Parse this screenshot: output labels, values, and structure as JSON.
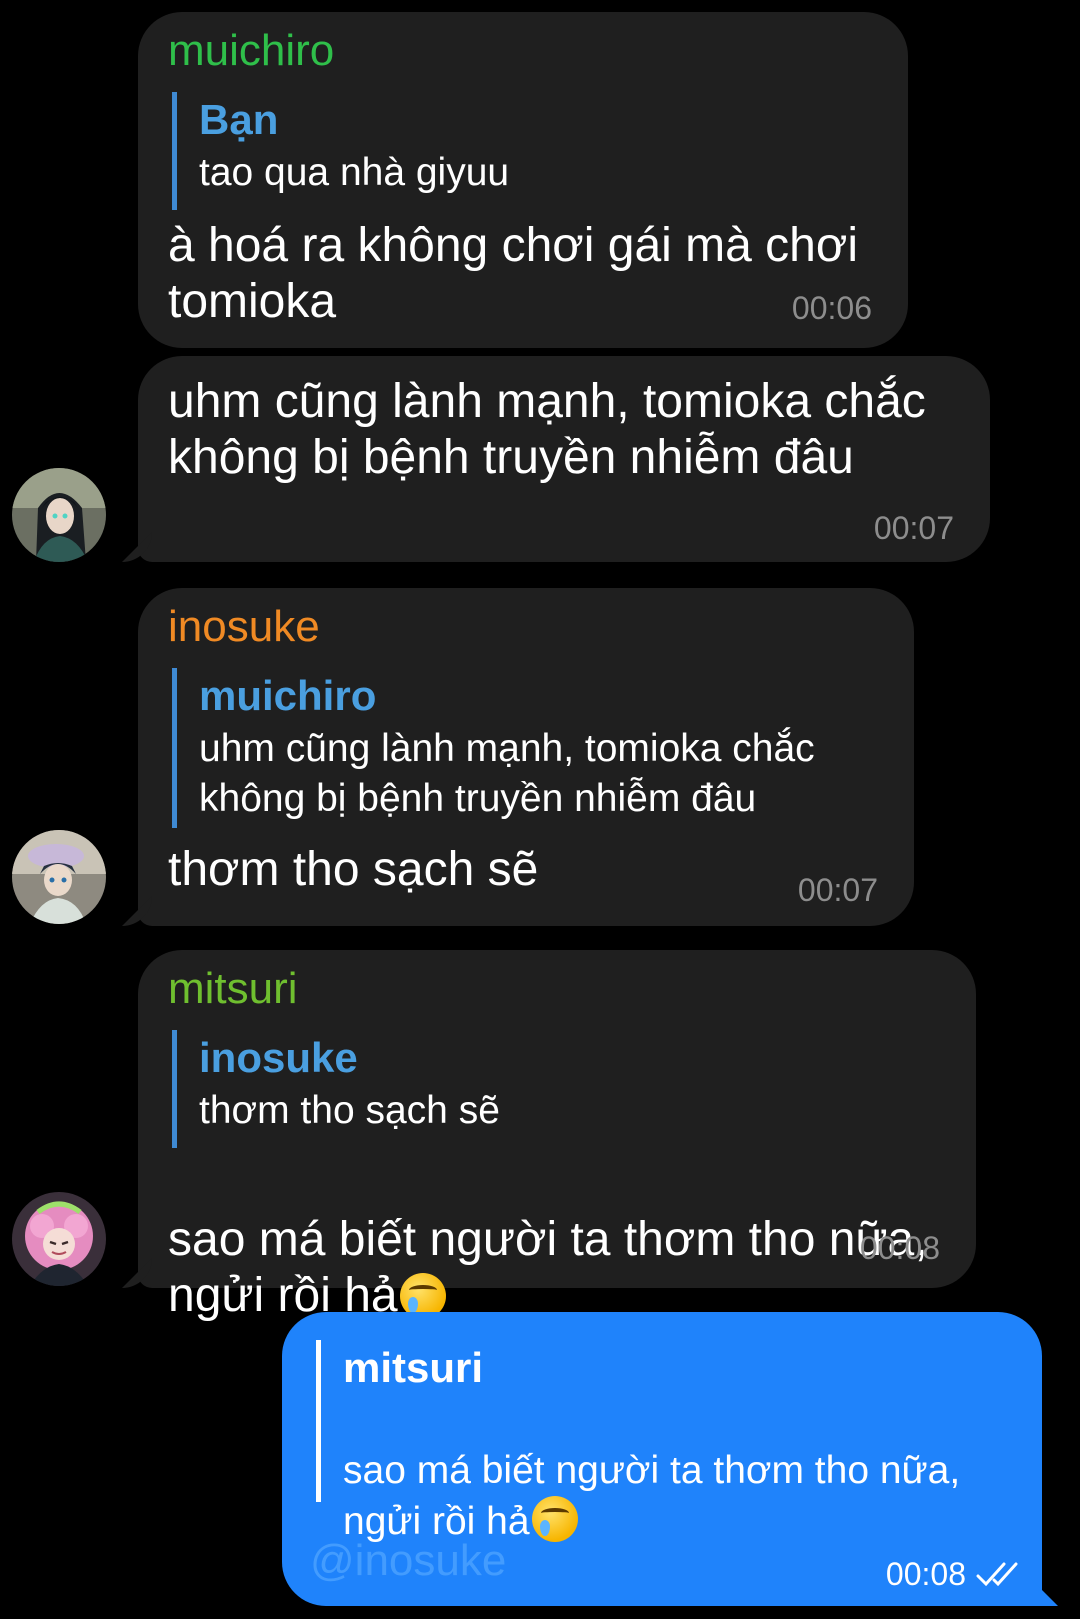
{
  "colors": {
    "background": "#000000",
    "bubble_in": "#1f1f1f",
    "bubble_out": "#1f83fb",
    "quote_bar": "#3f8ad3",
    "time_in": "#8d8d8d"
  },
  "messages": [
    {
      "sender": "muichiro",
      "sender_color": "#2fbf4a",
      "reply_name": "Bạn",
      "reply_text": "tao qua nhà giyuu",
      "text": "à hoá ra không chơi gái mà chơi\ntomioka",
      "time": "00:06"
    },
    {
      "text": "uhm cũng lành mạnh, tomioka chắc\nkhông bị bệnh truyền nhiễm đâu",
      "time": "00:07",
      "avatar": "muichiro-avatar"
    },
    {
      "sender": "inosuke",
      "sender_color": "#f08a24",
      "reply_name": "muichiro",
      "reply_text": "uhm cũng lành mạnh, tomioka chắc\nkhông bị bệnh truyền nhiễm đâu",
      "text": "thơm tho sạch sẽ",
      "time": "00:07",
      "avatar": "inosuke-avatar"
    },
    {
      "sender": "mitsuri",
      "sender_color": "#6fbf2f",
      "reply_name": "inosuke",
      "reply_text": "thơm tho sạch sẽ",
      "text": "sao má biết người ta thơm tho nữa,\nngửi rồi hả",
      "emoji": "smiling-face-with-tear-icon",
      "time": "00:08",
      "avatar": "mitsuri-avatar"
    },
    {
      "outgoing": true,
      "reply_name": "mitsuri",
      "reply_text": "sao má biết người ta thơm tho nữa,\nngửi rồi hả",
      "emoji": "smiling-face-with-tear-icon",
      "mention": "@inosuke",
      "time": "00:08",
      "status_icon": "double-check-icon"
    }
  ]
}
